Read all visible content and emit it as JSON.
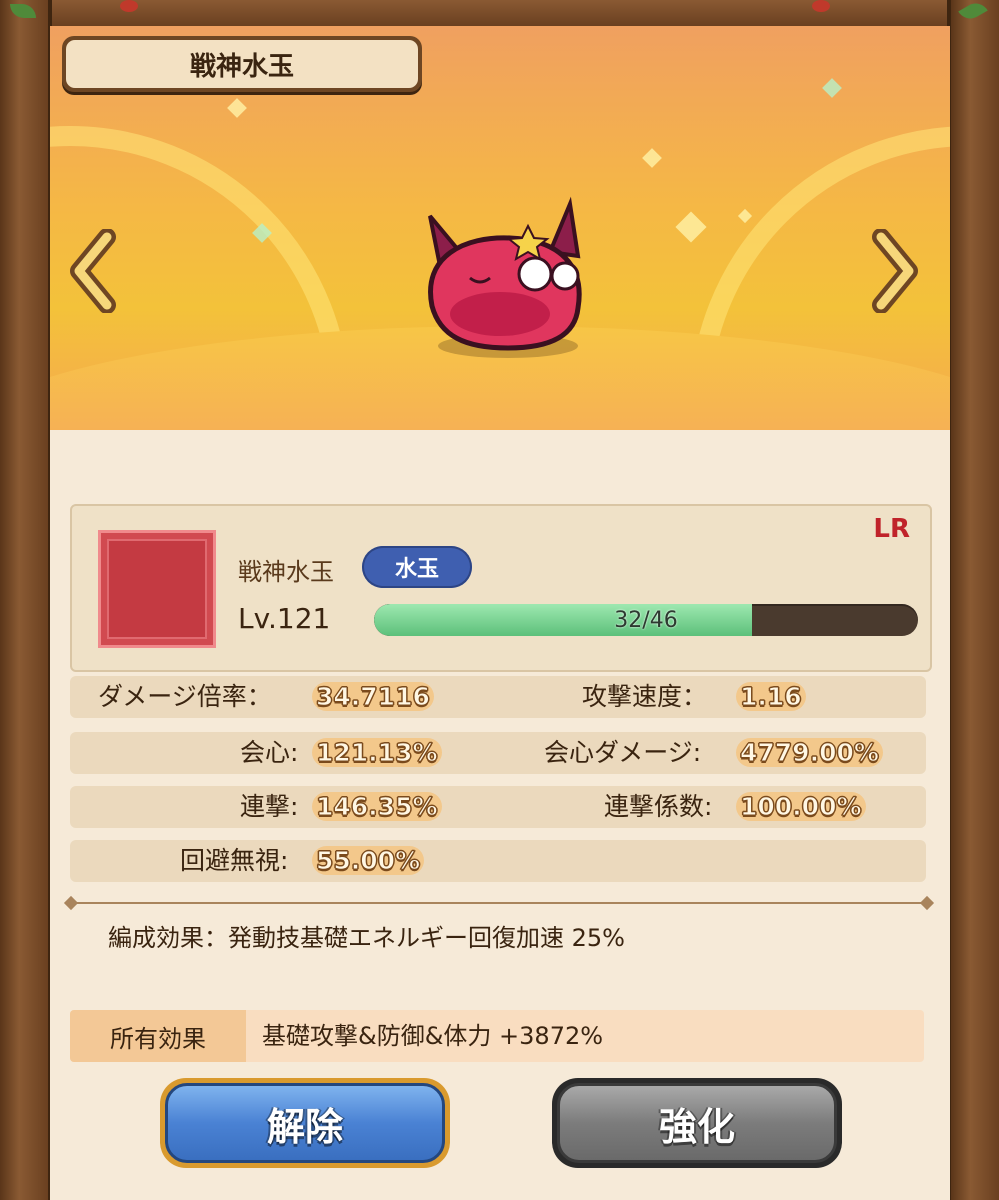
{
  "header": {
    "title": "戦神水玉"
  },
  "banner": {
    "prev_icon": "chevron-left-icon",
    "next_icon": "chevron-right-icon",
    "character_icon": "pink-slime-icon"
  },
  "character": {
    "name": "戦神水玉",
    "type_badge": "水玉",
    "level": "Lv.121",
    "exp_text": "32/46",
    "exp_progress": 0.6957,
    "rarity": "LR",
    "rarity_color": "#c0232a"
  },
  "stats": {
    "damage_rate_label": "ダメージ倍率：",
    "damage_rate_value": "34.7116",
    "attack_speed_label": "攻撃速度：",
    "attack_speed_value": "1.16",
    "crit_label": "会心:",
    "crit_value": "121.13%",
    "crit_damage_label": "会心ダメージ:",
    "crit_damage_value": "4779.00%",
    "combo_label": "連撃:",
    "combo_value": "146.35%",
    "combo_coef_label": "連撃係数:",
    "combo_coef_value": "100.00%",
    "ignore_evasion_label": "回避無視:",
    "ignore_evasion_value": "55.00%"
  },
  "effects": {
    "formation": "編成効果：発動技基礎エネルギー回復加速 25%",
    "owned_label": "所有効果",
    "owned_value": "基礎攻撃&防御&体力 +3872%"
  },
  "buttons": {
    "release": "解除",
    "upgrade": "強化"
  },
  "colors": {
    "release_button": "#4a82d4",
    "upgrade_button": "#7c7c7c",
    "exp_fill": "#5cc07a"
  }
}
